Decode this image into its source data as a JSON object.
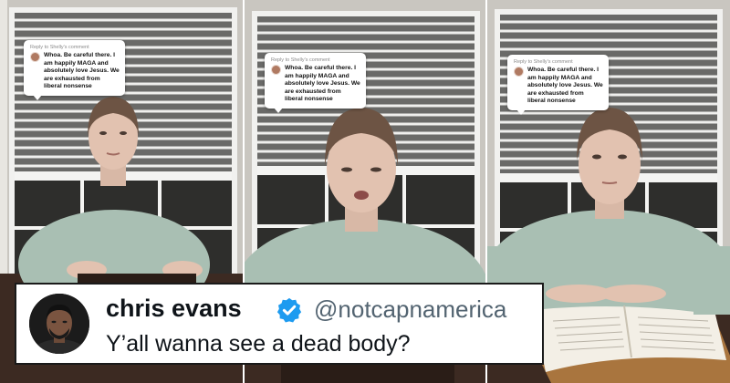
{
  "comment_card": {
    "reply_label": "Reply to Shelly's comment",
    "message": "Whoa. Be careful there. I am happily MAGA and absolutely love Jesus. We are exhausted from liberal nonsense"
  },
  "tweet": {
    "display_name": "chris evans",
    "handle": "@notcapnamerica",
    "text": "Y’all wanna see a dead body?",
    "verified_color": "#1d9bf0"
  },
  "colors": {
    "sweater": "#a9bfb3",
    "window_frame": "#f2f2f0",
    "tweet_border": "#1a1a1a"
  }
}
